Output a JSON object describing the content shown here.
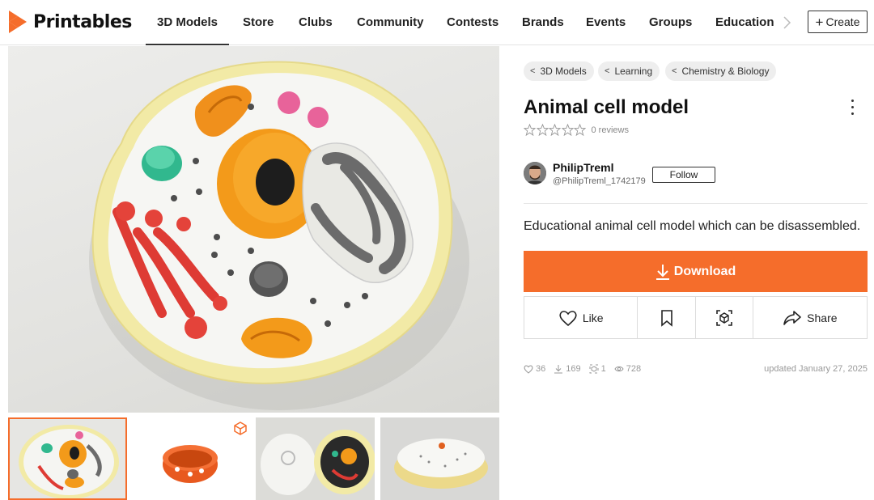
{
  "brand": {
    "name": "Printables",
    "color": "#f56d2b",
    "logo_icon": "printables-logo-icon"
  },
  "nav": {
    "items": [
      {
        "label": "3D Models",
        "active": true
      },
      {
        "label": "Store"
      },
      {
        "label": "Clubs"
      },
      {
        "label": "Community"
      },
      {
        "label": "Contests"
      },
      {
        "label": "Brands"
      },
      {
        "label": "Events"
      },
      {
        "label": "Groups"
      },
      {
        "label": "Education"
      }
    ],
    "more_icon": "chevron-right-icon",
    "create_label": "Create"
  },
  "gallery": {
    "main_alt": "Animal cell model photo",
    "thumbnails": [
      {
        "name": "thumb-1",
        "selected": true
      },
      {
        "name": "thumb-2",
        "badge_icon": "3d-cube-icon"
      },
      {
        "name": "thumb-3"
      },
      {
        "name": "thumb-4"
      }
    ]
  },
  "breadcrumbs": [
    "3D Models",
    "Learning",
    "Chemistry & Biology"
  ],
  "model": {
    "title": "Animal cell model",
    "rating": 0,
    "reviews_label": "0 reviews",
    "description": "Educational animal cell model which can be disassembled.",
    "download_label": "Download"
  },
  "author": {
    "name": "PhilipTreml",
    "handle": "@PhilipTreml_1742179",
    "follow_label": "Follow"
  },
  "actions": {
    "like_label": "Like",
    "share_label": "Share"
  },
  "stats": {
    "likes": "36",
    "downloads": "169",
    "makes": "1",
    "views": "728",
    "updated": "updated January 27, 2025"
  }
}
